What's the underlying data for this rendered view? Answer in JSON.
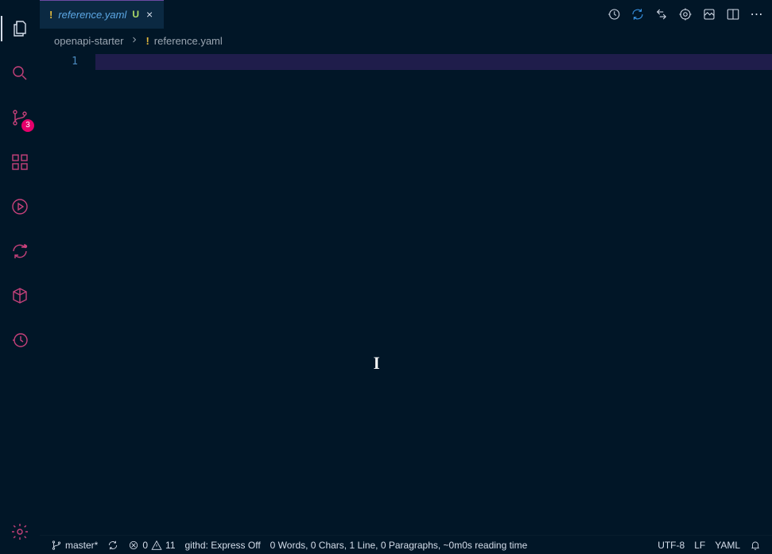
{
  "activity_bar": {
    "badge": "3"
  },
  "tab": {
    "file_icon": "!",
    "filename": "reference.yaml",
    "git_status": "U",
    "close": "×"
  },
  "tab_actions": {
    "more": "⋯"
  },
  "breadcrumb": {
    "root": "openapi-starter",
    "file_icon": "!",
    "filename": "reference.yaml"
  },
  "editor": {
    "line_number": "1",
    "cursor_glyph": "I"
  },
  "status": {
    "branch": "master*",
    "errors": "0",
    "warnings": "11",
    "githd": "githd: Express Off",
    "wordcount": "0 Words, 0 Chars, 1 Line, 0 Paragraphs, ~0m0s reading time",
    "encoding": "UTF-8",
    "eol": "LF",
    "language": "YAML"
  }
}
